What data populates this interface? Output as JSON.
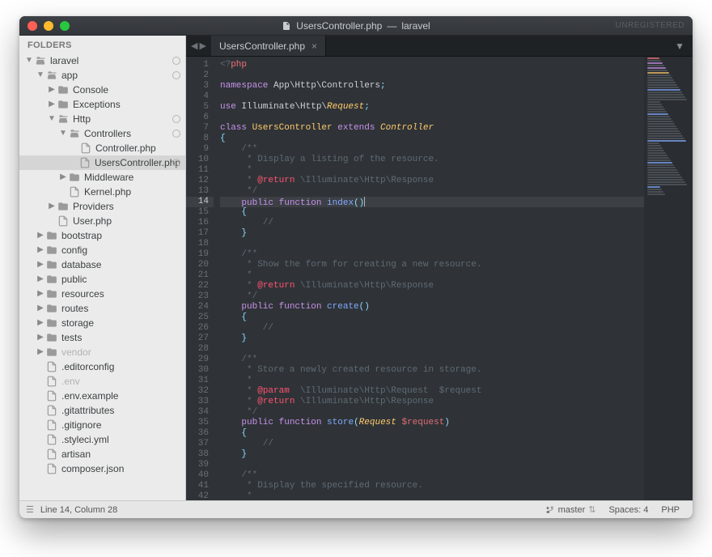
{
  "titlebar": {
    "filename": "UsersController.php",
    "project": "laravel",
    "separator": "—",
    "unregistered": "UNREGISTERED"
  },
  "sidebar": {
    "heading": "FOLDERS",
    "tree": [
      {
        "depth": 0,
        "expand": "open",
        "kind": "folder-open",
        "label": "laravel",
        "marker": true
      },
      {
        "depth": 1,
        "expand": "open",
        "kind": "folder-open",
        "label": "app",
        "marker": true
      },
      {
        "depth": 2,
        "expand": "closed",
        "kind": "folder",
        "label": "Console"
      },
      {
        "depth": 2,
        "expand": "closed",
        "kind": "folder",
        "label": "Exceptions"
      },
      {
        "depth": 2,
        "expand": "open",
        "kind": "folder-open",
        "label": "Http",
        "marker": true
      },
      {
        "depth": 3,
        "expand": "open",
        "kind": "folder-open",
        "label": "Controllers",
        "marker": true
      },
      {
        "depth": 4,
        "expand": "none",
        "kind": "file",
        "label": "Controller.php"
      },
      {
        "depth": 4,
        "expand": "none",
        "kind": "file",
        "label": "UsersController.php",
        "selected": true,
        "marker": true
      },
      {
        "depth": 3,
        "expand": "closed",
        "kind": "folder",
        "label": "Middleware"
      },
      {
        "depth": 3,
        "expand": "none",
        "kind": "file",
        "label": "Kernel.php"
      },
      {
        "depth": 2,
        "expand": "closed",
        "kind": "folder",
        "label": "Providers"
      },
      {
        "depth": 2,
        "expand": "none",
        "kind": "file",
        "label": "User.php"
      },
      {
        "depth": 1,
        "expand": "closed",
        "kind": "folder",
        "label": "bootstrap"
      },
      {
        "depth": 1,
        "expand": "closed",
        "kind": "folder",
        "label": "config"
      },
      {
        "depth": 1,
        "expand": "closed",
        "kind": "folder",
        "label": "database"
      },
      {
        "depth": 1,
        "expand": "closed",
        "kind": "folder",
        "label": "public"
      },
      {
        "depth": 1,
        "expand": "closed",
        "kind": "folder",
        "label": "resources"
      },
      {
        "depth": 1,
        "expand": "closed",
        "kind": "folder",
        "label": "routes"
      },
      {
        "depth": 1,
        "expand": "closed",
        "kind": "folder",
        "label": "storage"
      },
      {
        "depth": 1,
        "expand": "closed",
        "kind": "folder",
        "label": "tests"
      },
      {
        "depth": 1,
        "expand": "closed",
        "kind": "folder",
        "label": "vendor",
        "faded": true
      },
      {
        "depth": 1,
        "expand": "none",
        "kind": "file",
        "label": ".editorconfig"
      },
      {
        "depth": 1,
        "expand": "none",
        "kind": "file",
        "label": ".env",
        "faded": true
      },
      {
        "depth": 1,
        "expand": "none",
        "kind": "file",
        "label": ".env.example"
      },
      {
        "depth": 1,
        "expand": "none",
        "kind": "file",
        "label": ".gitattributes"
      },
      {
        "depth": 1,
        "expand": "none",
        "kind": "file",
        "label": ".gitignore"
      },
      {
        "depth": 1,
        "expand": "none",
        "kind": "file",
        "label": ".styleci.yml"
      },
      {
        "depth": 1,
        "expand": "none",
        "kind": "file",
        "label": "artisan"
      },
      {
        "depth": 1,
        "expand": "none",
        "kind": "file",
        "label": "composer.json"
      }
    ]
  },
  "tab": {
    "label": "UsersController.php"
  },
  "code": {
    "active_line": 14,
    "lines": [
      [
        {
          "c": "k-grey",
          "t": "<?"
        },
        {
          "c": "k-red",
          "t": "php"
        }
      ],
      [],
      [
        {
          "c": "k-purple",
          "t": "namespace "
        },
        {
          "c": "",
          "t": "App\\Http\\Controllers"
        },
        {
          "c": "k-cyan",
          "t": ";"
        }
      ],
      [],
      [
        {
          "c": "k-purple",
          "t": "use "
        },
        {
          "c": "",
          "t": "Illuminate\\Http\\"
        },
        {
          "c": "k-type",
          "t": "Request"
        },
        {
          "c": "k-cyan",
          "t": ";"
        }
      ],
      [],
      [
        {
          "c": "k-purple",
          "t": "class "
        },
        {
          "c": "k-yellow",
          "t": "UsersController "
        },
        {
          "c": "k-purple",
          "t": "extends "
        },
        {
          "c": "k-type",
          "t": "Controller"
        }
      ],
      [
        {
          "c": "k-cyan",
          "t": "{"
        }
      ],
      [
        {
          "c": "k-grey",
          "t": "    /**"
        }
      ],
      [
        {
          "c": "k-grey",
          "t": "     * Display a listing of the resource."
        }
      ],
      [
        {
          "c": "k-grey",
          "t": "     *"
        }
      ],
      [
        {
          "c": "k-grey",
          "t": "     * "
        },
        {
          "c": "k-pink",
          "t": "@return"
        },
        {
          "c": "k-grey",
          "t": " \\Illuminate\\Http\\Response"
        }
      ],
      [
        {
          "c": "k-grey",
          "t": "     */"
        }
      ],
      [
        {
          "c": "",
          "t": "    "
        },
        {
          "c": "k-purple",
          "t": "public "
        },
        {
          "c": "k-purple",
          "t": "function "
        },
        {
          "c": "k-fn",
          "t": "index"
        },
        {
          "c": "k-cyan",
          "t": "()"
        },
        {
          "c": "cursor",
          "t": ""
        }
      ],
      [
        {
          "c": "",
          "t": "    "
        },
        {
          "c": "k-cyan",
          "t": "{"
        }
      ],
      [
        {
          "c": "k-grey",
          "t": "        //"
        }
      ],
      [
        {
          "c": "",
          "t": "    "
        },
        {
          "c": "k-cyan",
          "t": "}"
        }
      ],
      [],
      [
        {
          "c": "k-grey",
          "t": "    /**"
        }
      ],
      [
        {
          "c": "k-grey",
          "t": "     * Show the form for creating a new resource."
        }
      ],
      [
        {
          "c": "k-grey",
          "t": "     *"
        }
      ],
      [
        {
          "c": "k-grey",
          "t": "     * "
        },
        {
          "c": "k-pink",
          "t": "@return"
        },
        {
          "c": "k-grey",
          "t": " \\Illuminate\\Http\\Response"
        }
      ],
      [
        {
          "c": "k-grey",
          "t": "     */"
        }
      ],
      [
        {
          "c": "",
          "t": "    "
        },
        {
          "c": "k-purple",
          "t": "public "
        },
        {
          "c": "k-purple",
          "t": "function "
        },
        {
          "c": "k-fn",
          "t": "create"
        },
        {
          "c": "k-cyan",
          "t": "()"
        }
      ],
      [
        {
          "c": "",
          "t": "    "
        },
        {
          "c": "k-cyan",
          "t": "{"
        }
      ],
      [
        {
          "c": "k-grey",
          "t": "        //"
        }
      ],
      [
        {
          "c": "",
          "t": "    "
        },
        {
          "c": "k-cyan",
          "t": "}"
        }
      ],
      [],
      [
        {
          "c": "k-grey",
          "t": "    /**"
        }
      ],
      [
        {
          "c": "k-grey",
          "t": "     * Store a newly created resource in storage."
        }
      ],
      [
        {
          "c": "k-grey",
          "t": "     *"
        }
      ],
      [
        {
          "c": "k-grey",
          "t": "     * "
        },
        {
          "c": "k-pink",
          "t": "@param"
        },
        {
          "c": "k-grey",
          "t": "  \\Illuminate\\Http\\Request  $request"
        }
      ],
      [
        {
          "c": "k-grey",
          "t": "     * "
        },
        {
          "c": "k-pink",
          "t": "@return"
        },
        {
          "c": "k-grey",
          "t": " \\Illuminate\\Http\\Response"
        }
      ],
      [
        {
          "c": "k-grey",
          "t": "     */"
        }
      ],
      [
        {
          "c": "",
          "t": "    "
        },
        {
          "c": "k-purple",
          "t": "public "
        },
        {
          "c": "k-purple",
          "t": "function "
        },
        {
          "c": "k-fn",
          "t": "store"
        },
        {
          "c": "k-cyan",
          "t": "("
        },
        {
          "c": "k-type",
          "t": "Request "
        },
        {
          "c": "k-var",
          "t": "$request"
        },
        {
          "c": "k-cyan",
          "t": ")"
        }
      ],
      [
        {
          "c": "",
          "t": "    "
        },
        {
          "c": "k-cyan",
          "t": "{"
        }
      ],
      [
        {
          "c": "k-grey",
          "t": "        //"
        }
      ],
      [
        {
          "c": "",
          "t": "    "
        },
        {
          "c": "k-cyan",
          "t": "}"
        }
      ],
      [],
      [
        {
          "c": "k-grey",
          "t": "    /**"
        }
      ],
      [
        {
          "c": "k-grey",
          "t": "     * Display the specified resource."
        }
      ],
      [
        {
          "c": "k-grey",
          "t": "     *"
        }
      ]
    ]
  },
  "status": {
    "cursor": "Line 14, Column 28",
    "branch": "master",
    "spaces": "Spaces: 4",
    "lang": "PHP"
  }
}
